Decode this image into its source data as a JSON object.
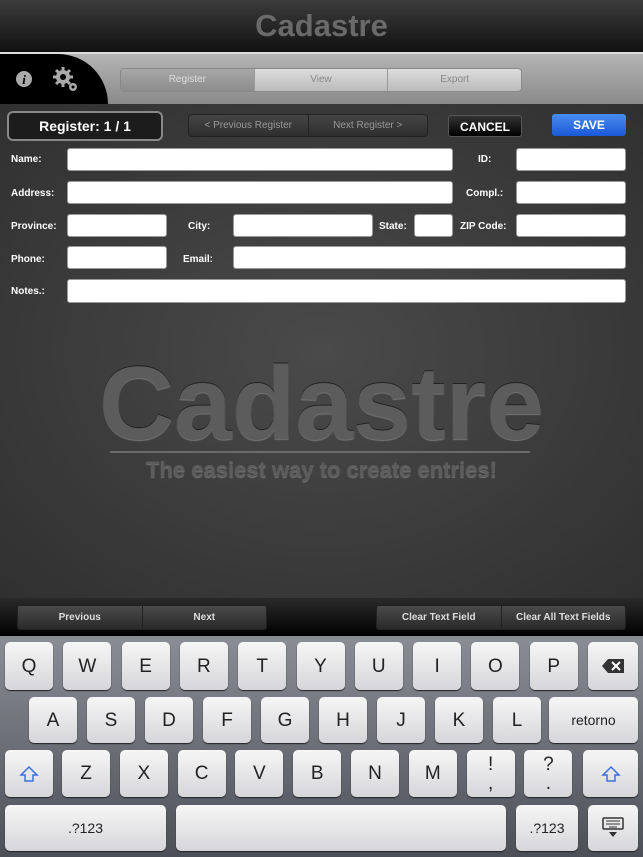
{
  "app": {
    "title": "Cadastre"
  },
  "toolbar": {
    "tabs": [
      {
        "label": "Register",
        "selected": true
      },
      {
        "label": "View"
      },
      {
        "label": "Export"
      }
    ],
    "icons": [
      "info-icon",
      "gear-icon"
    ]
  },
  "form": {
    "register_counter": "Register:  1 / 1",
    "previous_register": "< Previous Register",
    "next_register": "Next Register >",
    "cancel": "CANCEL",
    "save": "SAVE",
    "fields": {
      "name": {
        "label": "Name:",
        "value": ""
      },
      "id": {
        "label": "ID:",
        "value": ""
      },
      "address": {
        "label": "Address:",
        "value": ""
      },
      "compl": {
        "label": "Compl.:",
        "value": ""
      },
      "province": {
        "label": "Province:",
        "value": ""
      },
      "city": {
        "label": "City:",
        "value": ""
      },
      "state": {
        "label": "State:",
        "value": ""
      },
      "zip": {
        "label": "ZIP Code:",
        "value": ""
      },
      "phone": {
        "label": "Phone:",
        "value": ""
      },
      "email": {
        "label": "Email:",
        "value": ""
      },
      "notes": {
        "label": "Notes.:",
        "value": ""
      }
    }
  },
  "branding": {
    "logo": "Cadastre",
    "tagline": "The easiest way to create entries!"
  },
  "accessory": {
    "previous": "Previous",
    "next": "Next",
    "clear": "Clear Text Field",
    "clear_all": "Clear All Text Fields"
  },
  "keyboard": {
    "row1": [
      "Q",
      "W",
      "E",
      "R",
      "T",
      "Y",
      "U",
      "I",
      "O",
      "P"
    ],
    "row2": [
      "A",
      "S",
      "D",
      "F",
      "G",
      "H",
      "J",
      "K",
      "L"
    ],
    "row3": [
      "Z",
      "X",
      "C",
      "V",
      "B",
      "N",
      "M",
      "!\n,",
      "?\n."
    ],
    "return": "retorno",
    "numbers": ".?123",
    "accent": "#3a6fe0"
  }
}
